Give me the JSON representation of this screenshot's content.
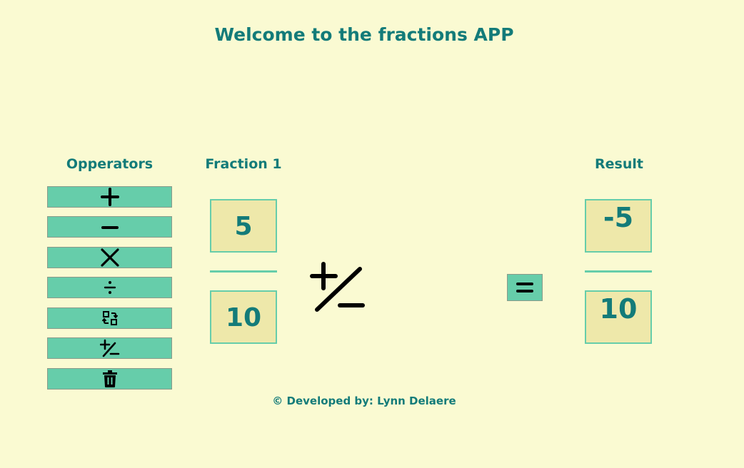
{
  "header": {
    "title": "Welcome to the fractions APP"
  },
  "operators": {
    "heading": "Opperators",
    "buttons": [
      {
        "name": "add",
        "icon": "plus-icon"
      },
      {
        "name": "subtract",
        "icon": "minus-icon"
      },
      {
        "name": "multiply",
        "icon": "times-icon"
      },
      {
        "name": "divide",
        "icon": "divide-icon"
      },
      {
        "name": "swap",
        "icon": "swap-icon"
      },
      {
        "name": "plus-minus",
        "icon": "plus-minus-icon"
      },
      {
        "name": "delete",
        "icon": "trash-icon"
      }
    ]
  },
  "fraction1": {
    "heading": "Fraction 1",
    "numerator": "5",
    "denominator": "10"
  },
  "current_operator": {
    "icon": "plus-minus-icon"
  },
  "equals": {
    "icon": "equals-icon"
  },
  "result": {
    "heading": "Result",
    "numerator": "-5",
    "denominator": "10"
  },
  "footer": {
    "credit": "© Developed by: Lynn Delaere"
  },
  "colors": {
    "background": "#fafad2",
    "accent_text": "#137b79",
    "button": "#66cdaa",
    "input_box": "#eee8aa"
  }
}
